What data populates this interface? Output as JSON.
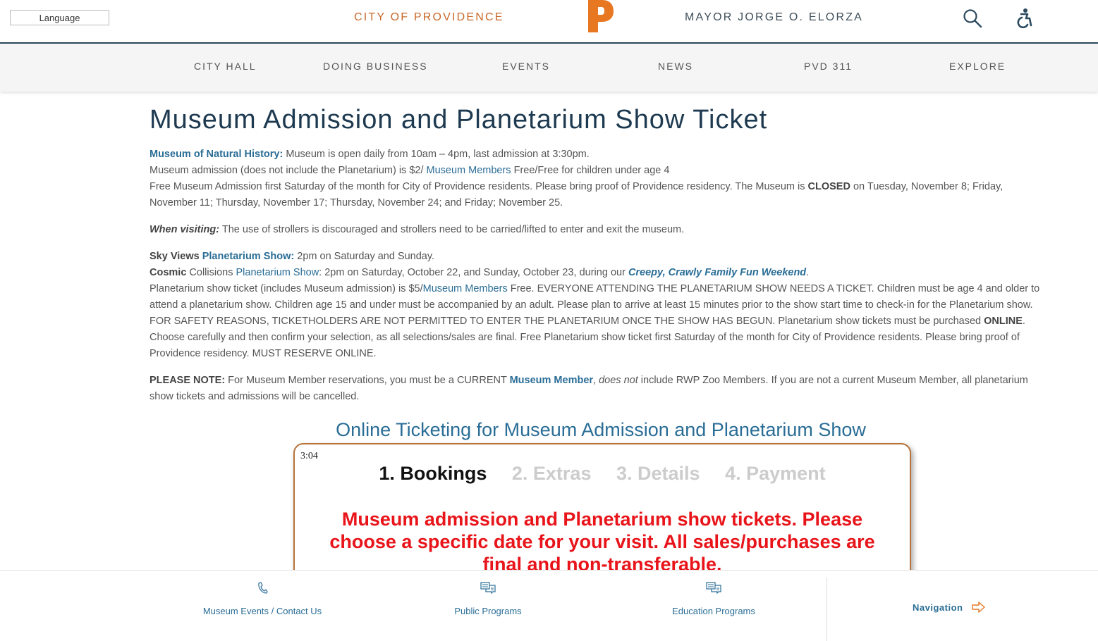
{
  "header": {
    "language_label": "Language",
    "city_title": "CITY OF PROVIDENCE",
    "mayor_title": "MAYOR JORGE O. ELORZA",
    "logo_letter": "P",
    "brand_color": "#e87722"
  },
  "nav": {
    "items": [
      "CITY HALL",
      "DOING BUSINESS",
      "EVENTS",
      "NEWS",
      "PVD 311",
      "EXPLORE"
    ]
  },
  "main": {
    "title": "Museum Admission and Planetarium Show Ticket",
    "p1": {
      "museum_link": "Museum of Natural History:",
      "hours": " Museum is open daily from 10am – 4pm, last admission at 3:30pm.",
      "admission_a": "Museum admission (does not include the Planetarium) is $2/ ",
      "members_link": "Museum Members",
      "admission_b": " Free/Free for children under age 4",
      "free_a": "Free Museum Admission first Saturday of the month for City of Providence residents. Please bring proof of Providence residency. The Museum is ",
      "closed": "CLOSED",
      "free_b": " on Tuesday, November 8; Friday, November 11; Thursday, November 17; Thursday, November 24; and Friday; November 25."
    },
    "p2": {
      "label": "When visiting:",
      "text": " The use of strollers is discouraged and strollers need to be carried/lifted to enter and exit the museum."
    },
    "p3": {
      "sky_label": "Sky Views ",
      "sky_link": "Planetarium Show:",
      "sky_text": " 2pm on Saturday and Sunday.",
      "cosmic_label": "Cosmic",
      "cosmic_a": " Collisions ",
      "cosmic_link": "Planetarium Show",
      "cosmic_b": ": 2pm on Saturday, October 22, and Sunday, October 23, during our ",
      "creepy_link": "Creepy, Crawly Family Fun Weekend",
      "cosmic_end": ".",
      "ticket_a": "Planetarium show ticket (includes Museum admission) is $5/",
      "members_link": "Museum Members",
      "ticket_b": " Free. EVERYONE ATTENDING THE PLANETARIUM SHOW NEEDS A TICKET. Children must be age 4 and older to attend a planetarium show. Children age 15 and under must be accompanied by an adult. Please plan to arrive at least 15 minutes prior to the show start time to check-in for the Planetarium show. FOR SAFETY REASONS, TICKETHOLDERS ARE NOT PERMITTED TO ENTER THE PLANETARIUM ONCE THE SHOW HAS BEGUN. Planetarium show tickets must be purchased ",
      "online": "ONLINE",
      "ticket_c": ". Choose carefully and then confirm your selection, as all selections/sales are final. Free Planetarium show ticket first Saturday of the month for City of Providence residents. Please bring proof of Providence residency. MUST RESERVE ONLINE."
    },
    "p4": {
      "label": "PLEASE NOTE:",
      "a": " For Museum Member reservations, you must be a CURRENT ",
      "member_link": "Museum Member",
      "comma": ", ",
      "not": "does not",
      "b": " include RWP Zoo Members. If you are not a current Museum Member, all planetarium show tickets and admissions will be cancelled."
    },
    "subtitle": "Online Ticketing for Museum Admission and Planetarium Show"
  },
  "widget": {
    "timer": "3:04",
    "steps": [
      "1. Bookings",
      "2. Extras",
      "3. Details",
      "4. Payment"
    ],
    "notice": "Museum admission and Planetarium show tickets. Please choose a specific date for your visit. All sales/purchases are final and non-transferable.",
    "notice_color": "#e8141a"
  },
  "footer": {
    "items": [
      {
        "label": "Museum Events / Contact Us",
        "icon": "phone-icon"
      },
      {
        "label": "Public Programs",
        "icon": "chat-icon"
      },
      {
        "label": "Education Programs",
        "icon": "chat-icon"
      }
    ],
    "navigation_label": "Navigation"
  }
}
